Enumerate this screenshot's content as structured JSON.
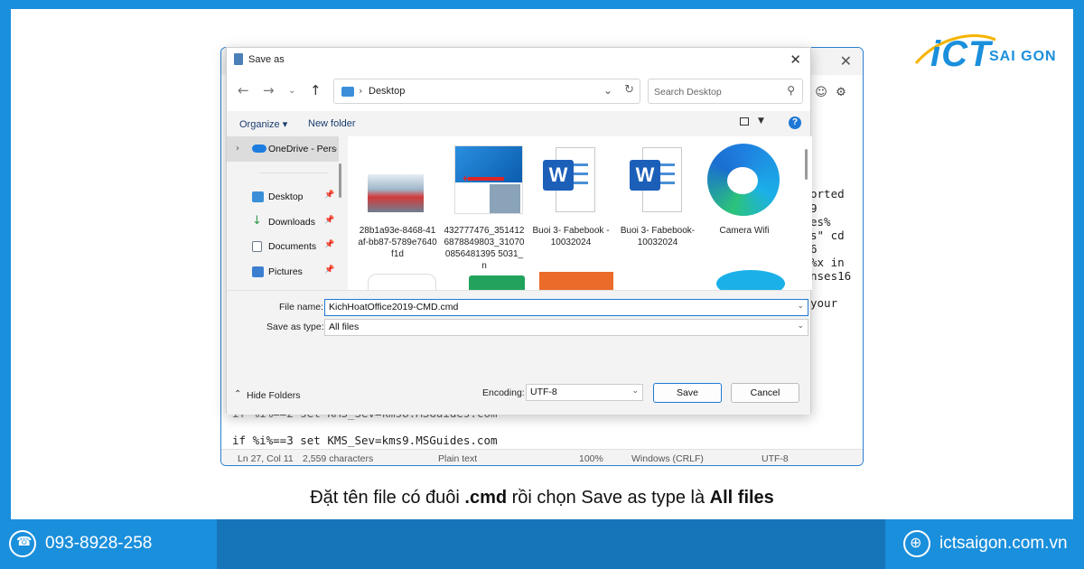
{
  "brand": {
    "ict": "iCT",
    "name": "SAI GON"
  },
  "notepad": {
    "code_right": [
      "orted",
      "9",
      "es%",
      "s\" cd",
      "6",
      "%x in",
      "nses16",
      "",
      "your"
    ],
    "code_bottom_partial": "if %i%==2 set KMS_Sev=kms8.MSGuides.com",
    "code_bottom": "if %i%==3 set KMS_Sev=kms9.MSGuides.com",
    "status": {
      "position": "Ln 27, Col 11",
      "chars": "2,559 characters",
      "format": "Plain text",
      "zoom": "100%",
      "eol": "Windows (CRLF)",
      "encoding": "UTF-8"
    }
  },
  "dialog": {
    "title": "Save as",
    "address": "Desktop",
    "search_placeholder": "Search Desktop",
    "organize": "Organize ▾",
    "new_folder": "New folder",
    "help": "?",
    "nav": {
      "onedrive": "OneDrive - Personal",
      "items": [
        {
          "label": "Desktop",
          "icon": "desktop-icon",
          "color": "#3a8fd8"
        },
        {
          "label": "Downloads",
          "icon": "download-icon",
          "color": "#2b9a4a"
        },
        {
          "label": "Documents",
          "icon": "documents-icon",
          "color": "#6b7a8c"
        },
        {
          "label": "Pictures",
          "icon": "pictures-icon",
          "color": "#3b7fd1"
        }
      ]
    },
    "files": [
      {
        "name": "28b1a93e-8468-41af-bb87-5789e7640f1d",
        "kind": "photo"
      },
      {
        "name": "432777476_3514126878849803_310700856481395 5031_n",
        "kind": "poster"
      },
      {
        "name": "Buoi 3- Fabebook - 10032024",
        "kind": "word"
      },
      {
        "name": "Buoi 3- Fabebook- 10032024",
        "kind": "word"
      },
      {
        "name": "Camera Wifi",
        "kind": "edge"
      }
    ],
    "file_name_label": "File name:",
    "file_name_value": "KichHoatOffice2019-CMD.cmd",
    "save_type_label": "Save as type:",
    "save_type_value": "All files",
    "hide_folders": "Hide Folders",
    "encoding_label": "Encoding:",
    "encoding_value": "UTF-8",
    "save": "Save",
    "cancel": "Cancel"
  },
  "caption": {
    "part1": "Đặt tên file có đuôi ",
    "bold1": ".cmd",
    "part2": " rồi chọn Save as type là ",
    "bold2": "All files"
  },
  "footer": {
    "phone": "093-8928-258",
    "website": "ictsaigon.com.vn"
  },
  "colors": {
    "brand_blue": "#1a8fdc",
    "accent": "#1e78d6"
  }
}
